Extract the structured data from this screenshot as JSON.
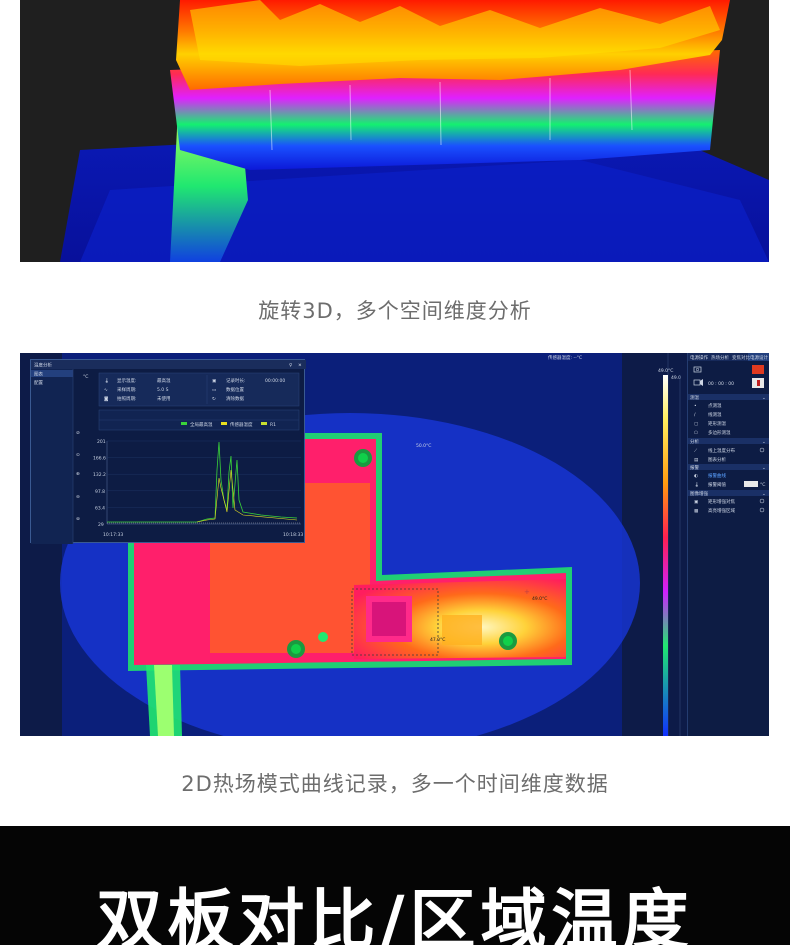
{
  "captions": {
    "rotate_3d": "旋转3D，多个空间维度分析",
    "curve_record": "2D热场模式曲线记录，多一个时间维度数据"
  },
  "banner": {
    "title": "双板对比/区域温度"
  },
  "thermal_ui": {
    "top_readout": "传感器温度: --°C",
    "panel": {
      "title": "温度分析",
      "menu": [
        "图表",
        "配置"
      ],
      "unit": "°C",
      "info_left": [
        {
          "label": "显示温度:",
          "value": "最高温"
        },
        {
          "label": "采样周期:",
          "value": "5.0 S"
        },
        {
          "label": "拍照周期:",
          "value": "未使用"
        }
      ],
      "info_right": [
        {
          "label": "记录时长:",
          "value": "00:00:00"
        },
        {
          "label": "数据位置",
          "value": ""
        },
        {
          "label": "清除数据",
          "value": ""
        }
      ],
      "legend": [
        "全局最高温",
        "传感器温度",
        "R1"
      ],
      "y_ticks": [
        "201",
        "166.6",
        "132.2",
        "97.8",
        "63.4",
        "29"
      ],
      "x_ticks": [
        "10:17:33",
        "10:18:33"
      ]
    },
    "spot_labels": {
      "center": "50.0°C",
      "hot": "49.0°C",
      "low": "47.0°C"
    },
    "scale": {
      "max": "49.0°C",
      "mark": "49.0"
    },
    "right_panel": {
      "tabs": [
        "电源操作",
        "热场分析",
        "变焦对比",
        "电源设计"
      ],
      "timer": "00 : 00 : 00",
      "sections": [
        {
          "title": "测温",
          "items": [
            "点测温",
            "线测温",
            "矩形测温",
            "多边形测温"
          ]
        },
        {
          "title": "分析",
          "items": [
            "线上温度分布",
            "图表分析"
          ]
        },
        {
          "title": "报警",
          "items": [
            "报警曲线",
            "报警阈值"
          ]
        },
        {
          "title": "图像增强",
          "items": [
            "矩形增强对焦",
            "高亮增强区域"
          ]
        }
      ],
      "threshold_unit": "°C"
    }
  }
}
